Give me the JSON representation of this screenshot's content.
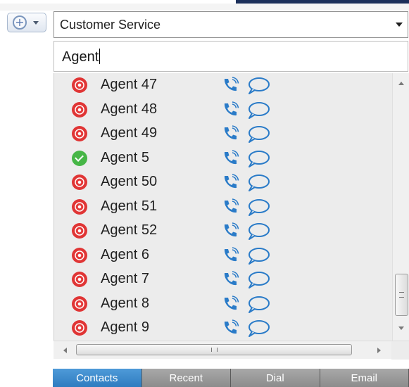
{
  "toolbar": {
    "add_button_icon": "plus-circle-icon"
  },
  "queue_select": {
    "value": "Customer Service"
  },
  "search": {
    "value": "Agent"
  },
  "contacts": [
    {
      "name": "Agent 47",
      "status": "busy"
    },
    {
      "name": "Agent 48",
      "status": "busy"
    },
    {
      "name": "Agent 49",
      "status": "busy"
    },
    {
      "name": "Agent 5",
      "status": "available"
    },
    {
      "name": "Agent 50",
      "status": "busy"
    },
    {
      "name": "Agent 51",
      "status": "busy"
    },
    {
      "name": "Agent 52",
      "status": "busy"
    },
    {
      "name": "Agent 6",
      "status": "busy"
    },
    {
      "name": "Agent 7",
      "status": "busy"
    },
    {
      "name": "Agent 8",
      "status": "busy"
    },
    {
      "name": "Agent 9",
      "status": "busy"
    }
  ],
  "tabs": [
    {
      "label": "Contacts",
      "active": true
    },
    {
      "label": "Recent",
      "active": false
    },
    {
      "label": "Dial",
      "active": false
    },
    {
      "label": "Email",
      "active": false
    }
  ],
  "colors": {
    "busy": "#e23a3a",
    "available": "#46b646",
    "action_icon": "#2a7bc8",
    "active_tab": "#3a86c8"
  }
}
